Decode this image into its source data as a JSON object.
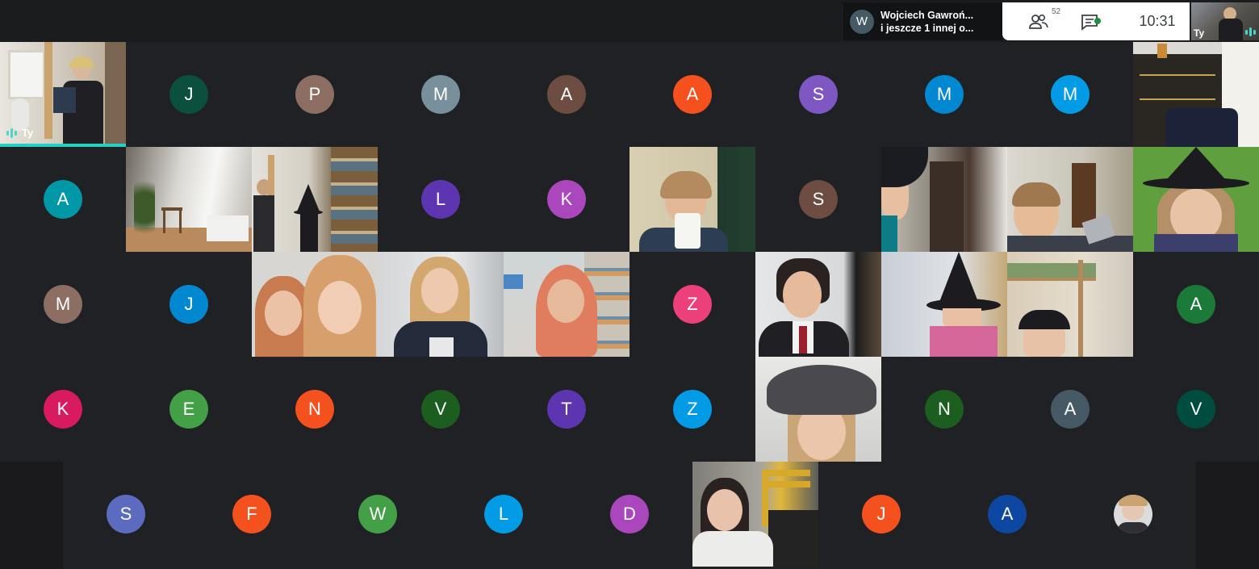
{
  "presenter": {
    "avatar_letter": "W",
    "line1": "Wojciech Gawroń...",
    "line2": "i jeszcze 1 innej o..."
  },
  "controls": {
    "people_count": "52",
    "time": "10:31"
  },
  "self_label": "Ty",
  "colors": {
    "accent": "#24d1c0",
    "background": "#202124"
  },
  "tiles": [
    {
      "id": "r1c1",
      "kind": "video",
      "video": "self-reading",
      "name": "Ty",
      "speaking": true
    },
    {
      "id": "r1c2",
      "kind": "avatar",
      "letter": "J",
      "color": "#0b4f3f"
    },
    {
      "id": "r1c3",
      "kind": "avatar",
      "letter": "P",
      "color": "#8d6e63"
    },
    {
      "id": "r1c4",
      "kind": "avatar",
      "letter": "M",
      "color": "#78909c"
    },
    {
      "id": "r1c5",
      "kind": "avatar",
      "letter": "A",
      "color": "#6d4c41"
    },
    {
      "id": "r1c6",
      "kind": "avatar",
      "letter": "A",
      "color": "#f4511e"
    },
    {
      "id": "r1c7",
      "kind": "avatar",
      "letter": "S",
      "color": "#7e57c2"
    },
    {
      "id": "r1c8",
      "kind": "avatar",
      "letter": "M",
      "color": "#0288d1"
    },
    {
      "id": "r1c9",
      "kind": "avatar",
      "letter": "M",
      "color": "#039be5"
    },
    {
      "id": "r1c10",
      "kind": "video",
      "video": "room-dresser"
    },
    {
      "id": "r2c1",
      "kind": "avatar",
      "letter": "A",
      "color": "#0097a7"
    },
    {
      "id": "r2c2",
      "kind": "video",
      "video": "empty-bright-room"
    },
    {
      "id": "r2c3",
      "kind": "video",
      "video": "reading-witch"
    },
    {
      "id": "r2c4",
      "kind": "avatar",
      "letter": "L",
      "color": "#5e35b1"
    },
    {
      "id": "r2c5",
      "kind": "avatar",
      "letter": "K",
      "color": "#ab47bc"
    },
    {
      "id": "r2c6",
      "kind": "video",
      "video": "woman-mug"
    },
    {
      "id": "r2c7",
      "kind": "avatar",
      "letter": "S",
      "color": "#6d4c41"
    },
    {
      "id": "r2c8",
      "kind": "video",
      "video": "witch-hat-girl"
    },
    {
      "id": "r2c9",
      "kind": "video",
      "video": "boy-toy"
    },
    {
      "id": "r2c10",
      "kind": "video",
      "video": "witch-green"
    },
    {
      "id": "r3c1",
      "kind": "avatar",
      "letter": "M",
      "color": "#8d6e63"
    },
    {
      "id": "r3c2",
      "kind": "avatar",
      "letter": "J",
      "color": "#0288d1"
    },
    {
      "id": "r3c3",
      "kind": "video",
      "video": "two-girls"
    },
    {
      "id": "r3c4",
      "kind": "video",
      "video": "blonde-girl"
    },
    {
      "id": "r3c5",
      "kind": "video",
      "video": "hoodie-girl"
    },
    {
      "id": "r3c6",
      "kind": "avatar",
      "letter": "Z",
      "color": "#ec407a"
    },
    {
      "id": "r3c7",
      "kind": "video",
      "video": "woman-uniform"
    },
    {
      "id": "r3c8",
      "kind": "video",
      "video": "child-hat"
    },
    {
      "id": "r3c9",
      "kind": "video",
      "video": "bunk-bed-boy"
    },
    {
      "id": "r3c10",
      "kind": "avatar",
      "letter": "A",
      "color": "#1b7a3a"
    },
    {
      "id": "r4c1",
      "kind": "avatar",
      "letter": "K",
      "color": "#d81b60"
    },
    {
      "id": "r4c2",
      "kind": "avatar",
      "letter": "E",
      "color": "#43a047"
    },
    {
      "id": "r4c3",
      "kind": "avatar",
      "letter": "N",
      "color": "#f4511e"
    },
    {
      "id": "r4c4",
      "kind": "avatar",
      "letter": "V",
      "color": "#1b5e20"
    },
    {
      "id": "r4c5",
      "kind": "avatar",
      "letter": "T",
      "color": "#5e35b1"
    },
    {
      "id": "r4c6",
      "kind": "avatar",
      "letter": "Z",
      "color": "#039be5"
    },
    {
      "id": "r4c7",
      "kind": "video",
      "video": "woman-grey-hat"
    },
    {
      "id": "r4c8",
      "kind": "avatar",
      "letter": "N",
      "color": "#1b5e20"
    },
    {
      "id": "r4c9",
      "kind": "avatar",
      "letter": "A",
      "color": "#455a64"
    },
    {
      "id": "r4c10",
      "kind": "avatar",
      "letter": "V",
      "color": "#004d40"
    },
    {
      "id": "r5c1",
      "kind": "avatar",
      "letter": "S",
      "color": "#5c6bc0"
    },
    {
      "id": "r5c2",
      "kind": "avatar",
      "letter": "F",
      "color": "#f4511e"
    },
    {
      "id": "r5c3",
      "kind": "avatar",
      "letter": "W",
      "color": "#43a047"
    },
    {
      "id": "r5c4",
      "kind": "avatar",
      "letter": "L",
      "color": "#039be5"
    },
    {
      "id": "r5c5",
      "kind": "avatar",
      "letter": "D",
      "color": "#ab47bc"
    },
    {
      "id": "r5c6",
      "kind": "video",
      "video": "girl-yellow-chair"
    },
    {
      "id": "r5c7",
      "kind": "avatar",
      "letter": "J",
      "color": "#f4511e"
    },
    {
      "id": "r5c8",
      "kind": "avatar",
      "letter": "A",
      "color": "#0d47a1"
    },
    {
      "id": "r5c9",
      "kind": "photo",
      "video": "profile-photo"
    }
  ]
}
